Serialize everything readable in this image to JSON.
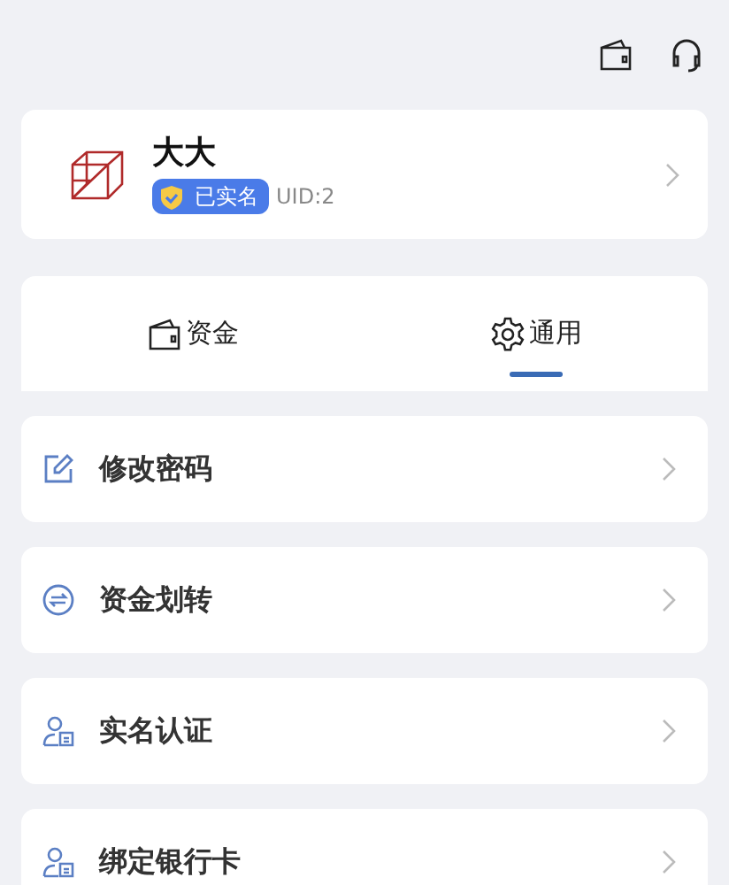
{
  "profile": {
    "name": "大大",
    "badge": "已实名",
    "uid": "UID:2"
  },
  "tabs": [
    {
      "label": "资金",
      "kind": "wallet",
      "selected": false
    },
    {
      "label": "通用",
      "kind": "gear",
      "selected": true
    }
  ],
  "menu": [
    {
      "label": "修改密码",
      "kind": "edit"
    },
    {
      "label": "资金划转",
      "kind": "transfer"
    },
    {
      "label": "实名认证",
      "kind": "identity"
    },
    {
      "label": "绑定银行卡",
      "kind": "identity"
    }
  ]
}
